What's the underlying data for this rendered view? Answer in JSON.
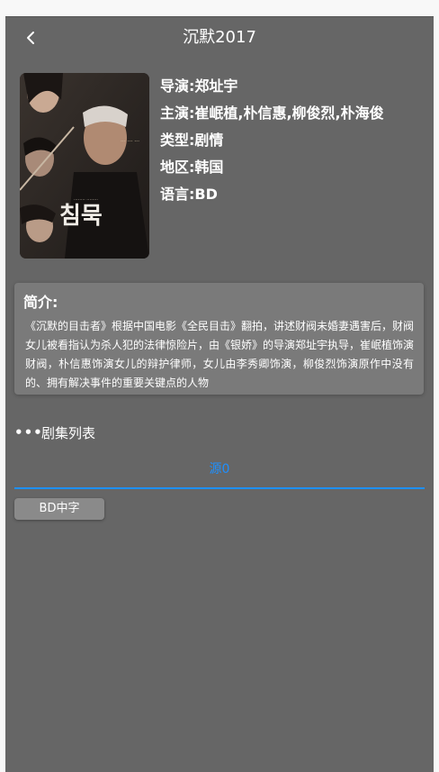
{
  "header": {
    "title": "沉默2017",
    "back_icon": "chevron-left-icon"
  },
  "movie": {
    "director": "导演:郑址宇",
    "cast": "主演:崔岷植,朴信惠,柳俊烈,朴海俊",
    "genre": "类型:剧情",
    "region": "地区:韩国",
    "language": "语言:BD",
    "poster_text": "침묵"
  },
  "intro": {
    "title": "简介:",
    "text": "《沉默的目击者》根据中国电影《全民目击》翻拍，讲述财阀未婚妻遇害后，财阀女儿被看指认为杀人犯的法律惊险片，由《银娇》的导演郑址宇执导，崔岷植饰演财阀，朴信惠饰演女儿的辩护律师，女儿由李秀卿饰演，柳俊烈饰演原作中没有的、拥有解决事件的重要关键点的人物"
  },
  "episodes": {
    "section_label": "剧集列表",
    "dots": "•••",
    "source_tab": "源0",
    "items": [
      {
        "label": "BD中字"
      }
    ]
  },
  "colors": {
    "background": "#666666",
    "accent": "#1e90ff",
    "card": "#7a7a7a"
  }
}
